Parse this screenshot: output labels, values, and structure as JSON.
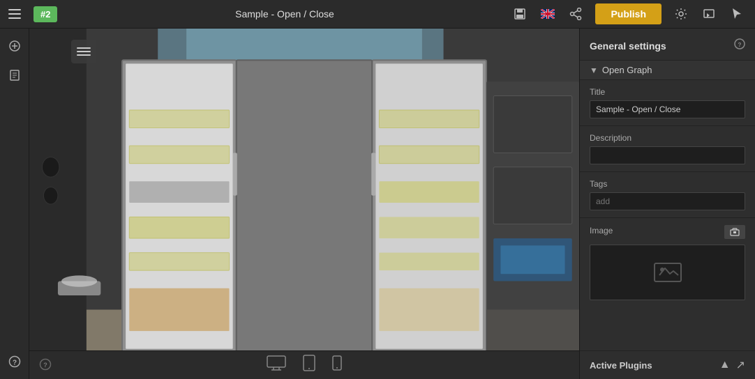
{
  "topbar": {
    "menu_icon": "☰",
    "tab_label": "#2",
    "title": "Sample - Open / Close",
    "save_icon": "💾",
    "lang_icon": "🇬🇧",
    "share_icon": "🔗",
    "publish_label": "Publish",
    "settings_icon": "⚙",
    "preview_icon": "🖼",
    "cursor_icon": "↖"
  },
  "leftsidebar": {
    "add_icon": "+",
    "pages_icon": "📄",
    "help_icon": "?"
  },
  "canvas": {
    "hamburger_title": "menu"
  },
  "bottombar": {
    "desktop_icon": "🖥",
    "tablet_icon": "📱",
    "mobile_icon": "📱",
    "help_icon": "?"
  },
  "right_panel": {
    "header_title": "General settings",
    "help_icon": "?",
    "open_graph": {
      "section_label": "Open Graph",
      "title_label": "Title",
      "title_value": "Sample - Open / Close",
      "description_label": "Description",
      "description_value": "",
      "description_placeholder": "",
      "tags_label": "Tags",
      "tags_placeholder": "add",
      "image_label": "Image",
      "browse_icon": "📁"
    },
    "active_plugins": {
      "label": "Active Plugins",
      "collapse_icon": "▲",
      "expand_icon": "↗"
    }
  }
}
